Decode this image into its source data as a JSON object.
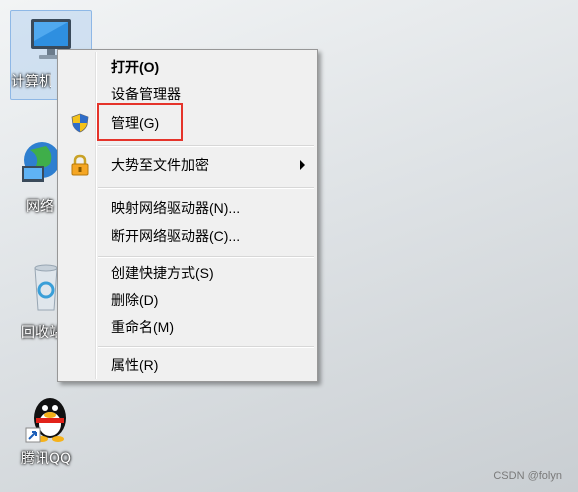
{
  "desktop": {
    "icons": [
      {
        "label": "计算机"
      },
      {
        "label": "网络"
      },
      {
        "label": "回收站"
      },
      {
        "label": "腾讯QQ"
      }
    ]
  },
  "context_menu": {
    "items": [
      {
        "label": "打开(O)"
      },
      {
        "label": "设备管理器"
      },
      {
        "label": "管理(G)"
      },
      {
        "label": "大势至文件加密"
      },
      {
        "label": "映射网络驱动器(N)..."
      },
      {
        "label": "断开网络驱动器(C)..."
      },
      {
        "label": "创建快捷方式(S)"
      },
      {
        "label": "删除(D)"
      },
      {
        "label": "重命名(M)"
      },
      {
        "label": "属性(R)"
      }
    ]
  },
  "watermark": "CSDN @folyn",
  "colors": {
    "highlight_box": "#e5332a"
  }
}
